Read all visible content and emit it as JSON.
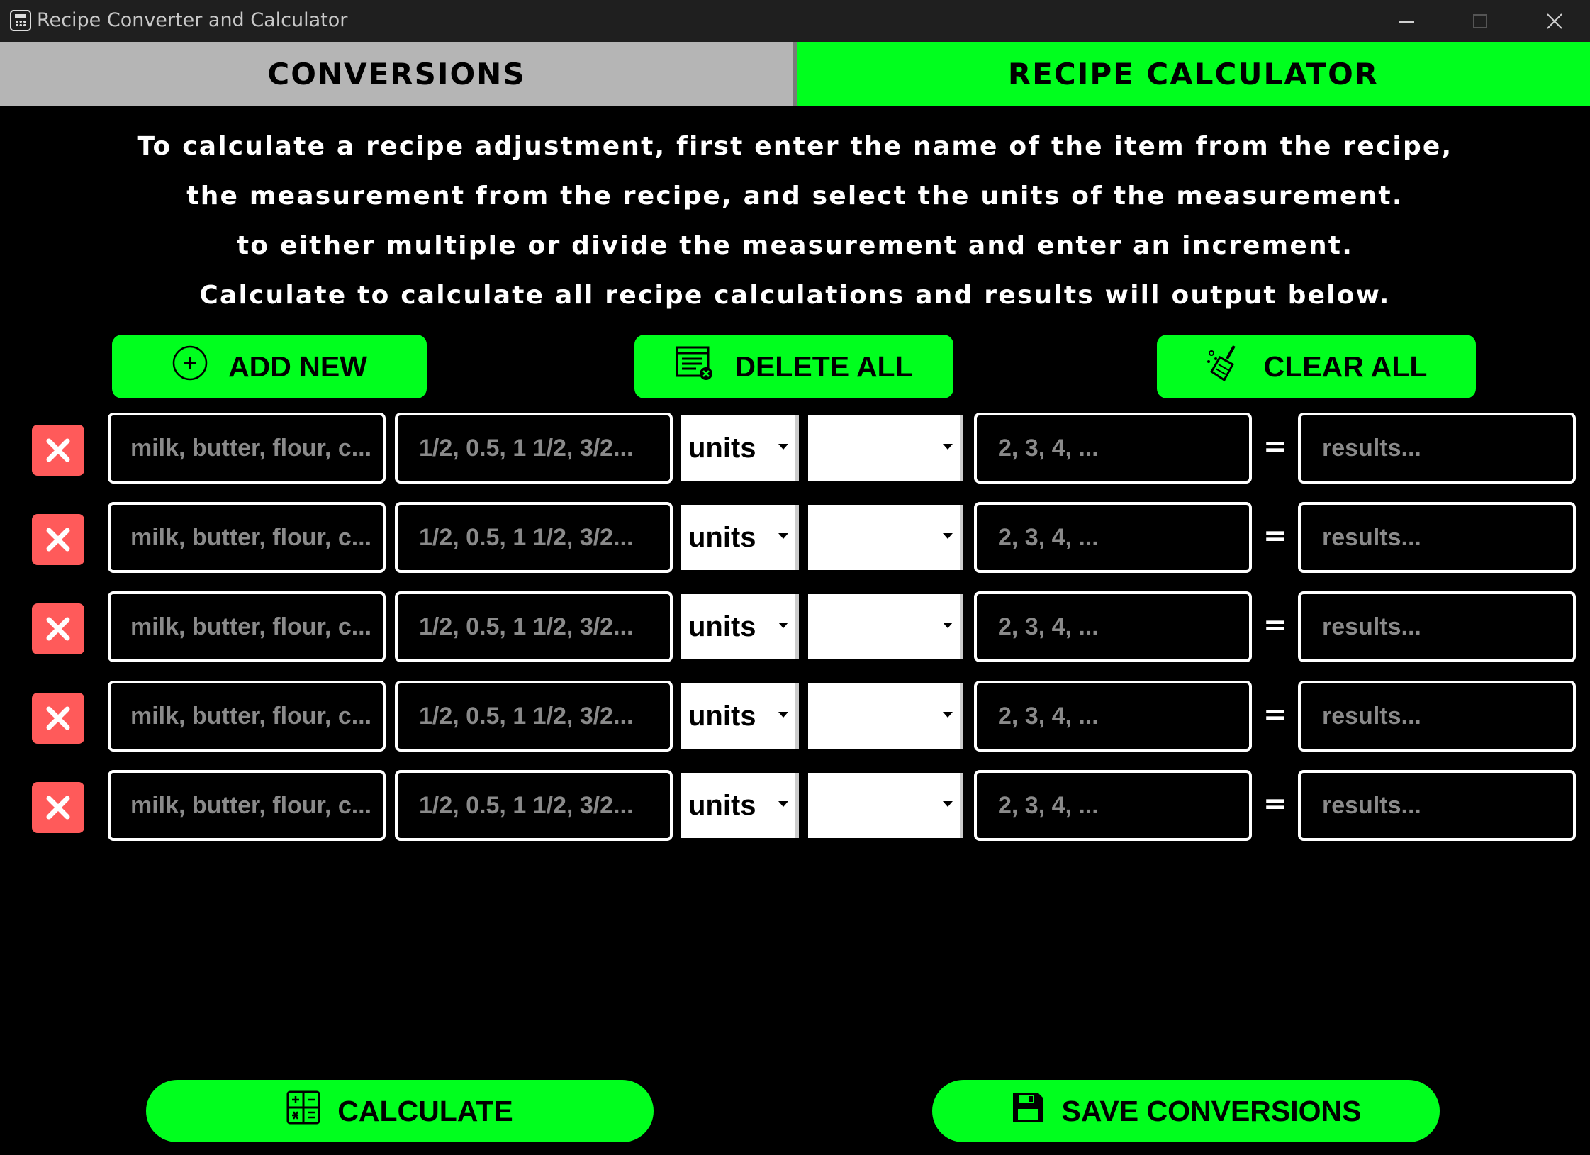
{
  "window": {
    "title": "Recipe Converter and Calculator"
  },
  "tabs": {
    "conversions": "CONVERSIONS",
    "recipe_calculator": "RECIPE CALCULATOR",
    "active": "recipe_calculator"
  },
  "instructions": [
    "To calculate a recipe adjustment, first enter the name of the item from the recipe,",
    "the measurement from the recipe, and select the units of the measurement.",
    "to either multiple or divide the measurement and enter an increment.",
    "Calculate to calculate all recipe calculations and results will output below."
  ],
  "actions": {
    "add_new": "ADD NEW",
    "delete_all": "DELETE ALL",
    "clear_all": "CLEAR ALL"
  },
  "rows": [
    {
      "item_placeholder": "milk, butter, flour, c...",
      "measurement_placeholder": "1/2, 0.5, 1 1/2, 3/2...",
      "units": "units",
      "operation": "",
      "increment_placeholder": "2, 3, 4, ...",
      "equals": "=",
      "result_placeholder": "results..."
    },
    {
      "item_placeholder": "milk, butter, flour, c...",
      "measurement_placeholder": "1/2, 0.5, 1 1/2, 3/2...",
      "units": "units",
      "operation": "",
      "increment_placeholder": "2, 3, 4, ...",
      "equals": "=",
      "result_placeholder": "results..."
    },
    {
      "item_placeholder": "milk, butter, flour, c...",
      "measurement_placeholder": "1/2, 0.5, 1 1/2, 3/2...",
      "units": "units",
      "operation": "",
      "increment_placeholder": "2, 3, 4, ...",
      "equals": "=",
      "result_placeholder": "results..."
    },
    {
      "item_placeholder": "milk, butter, flour, c...",
      "measurement_placeholder": "1/2, 0.5, 1 1/2, 3/2...",
      "units": "units",
      "operation": "",
      "increment_placeholder": "2, 3, 4, ...",
      "equals": "=",
      "result_placeholder": "results..."
    },
    {
      "item_placeholder": "milk, butter, flour, c...",
      "measurement_placeholder": "1/2, 0.5, 1 1/2, 3/2...",
      "units": "units",
      "operation": "",
      "increment_placeholder": "2, 3, 4, ...",
      "equals": "=",
      "result_placeholder": "results..."
    }
  ],
  "bottom": {
    "calculate": "CALCULATE",
    "save_conversions": "SAVE CONVERSIONS"
  },
  "colors": {
    "accent_green": "#00ff1e",
    "delete_red": "#ff5a5a",
    "inactive_tab": "#b5b5b5",
    "background": "#000000"
  },
  "icons": {
    "add_new": "plus-circle-icon",
    "delete_all": "list-delete-icon",
    "clear_all": "broom-icon",
    "row_delete": "close-icon",
    "calculate": "calculator-icon",
    "save": "save-disk-icon"
  }
}
